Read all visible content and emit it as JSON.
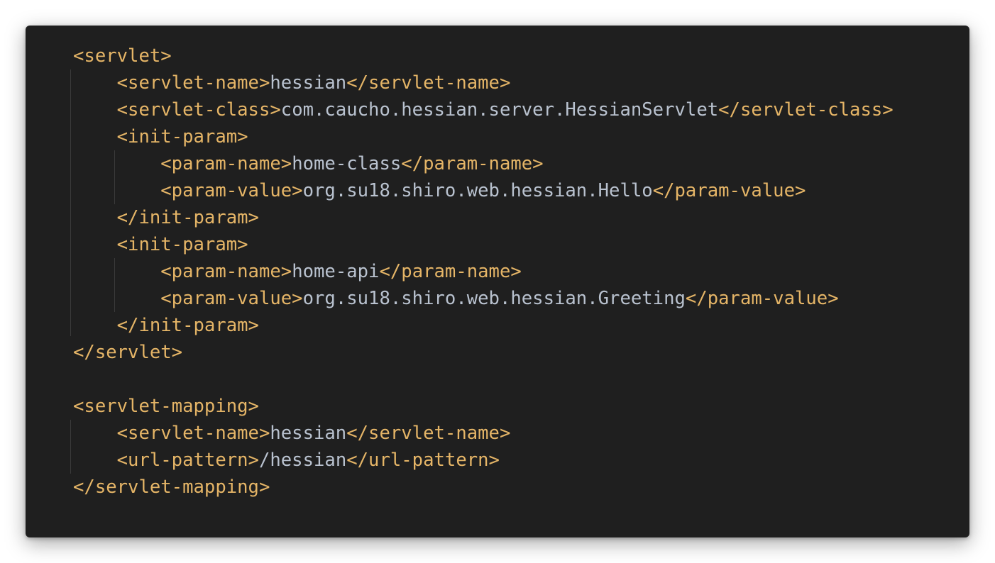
{
  "code_lines": [
    [
      {
        "t": "tag",
        "v": "<servlet>"
      }
    ],
    [
      {
        "t": "tag",
        "v": "    <servlet-name>"
      },
      {
        "t": "txt",
        "v": "hessian"
      },
      {
        "t": "tag",
        "v": "</servlet-name>"
      }
    ],
    [
      {
        "t": "tag",
        "v": "    <servlet-class>"
      },
      {
        "t": "txt",
        "v": "com.caucho.hessian.server.HessianServlet"
      },
      {
        "t": "tag",
        "v": "</servlet-class>"
      }
    ],
    [
      {
        "t": "tag",
        "v": "    <init-param>"
      }
    ],
    [
      {
        "t": "tag",
        "v": "        <param-name>"
      },
      {
        "t": "txt",
        "v": "home-class"
      },
      {
        "t": "tag",
        "v": "</param-name>"
      }
    ],
    [
      {
        "t": "tag",
        "v": "        <param-value>"
      },
      {
        "t": "txt",
        "v": "org.su18.shiro.web.hessian.Hello"
      },
      {
        "t": "tag",
        "v": "</param-value>"
      }
    ],
    [
      {
        "t": "tag",
        "v": "    </init-param>"
      }
    ],
    [
      {
        "t": "tag",
        "v": "    <init-param>"
      }
    ],
    [
      {
        "t": "tag",
        "v": "        <param-name>"
      },
      {
        "t": "txt",
        "v": "home-api"
      },
      {
        "t": "tag",
        "v": "</param-name>"
      }
    ],
    [
      {
        "t": "tag",
        "v": "        <param-value>"
      },
      {
        "t": "txt",
        "v": "org.su18.shiro.web.hessian.Greeting"
      },
      {
        "t": "tag",
        "v": "</param-value>"
      }
    ],
    [
      {
        "t": "tag",
        "v": "    </init-param>"
      }
    ],
    [
      {
        "t": "tag",
        "v": "</servlet>"
      }
    ],
    [],
    [
      {
        "t": "tag",
        "v": "<servlet-mapping>"
      }
    ],
    [
      {
        "t": "tag",
        "v": "    <servlet-name>"
      },
      {
        "t": "txt",
        "v": "hessian"
      },
      {
        "t": "tag",
        "v": "</servlet-name>"
      }
    ],
    [
      {
        "t": "tag",
        "v": "    <url-pattern>"
      },
      {
        "t": "txt",
        "v": "/hessian"
      },
      {
        "t": "tag",
        "v": "</url-pattern>"
      }
    ],
    [
      {
        "t": "tag",
        "v": "</servlet-mapping>"
      }
    ]
  ],
  "colors": {
    "background": "#1f1f1f",
    "tag": "#e5b567",
    "text": "#b9c2cf",
    "indent_guide": "#3a3a3a"
  }
}
